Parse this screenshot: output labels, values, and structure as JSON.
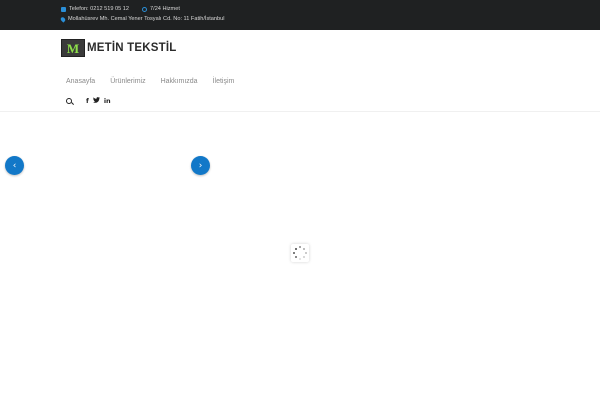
{
  "topbar": {
    "phone": "Telefon: 0212 519 05 12",
    "hours": "7/24 Hizmet",
    "address": "Mollahüsrev Mh. Cemal Yener Tosyalı Cd. No: 11 Fatih/İstanbul"
  },
  "logo": {
    "mark": "M",
    "text": "METİN TEKSTİL"
  },
  "nav": {
    "items": [
      "Anasayfa",
      "Ürünlerimiz",
      "Hakkımızda",
      "İletişim"
    ]
  },
  "social": {
    "facebook": "f",
    "twitter": "🐦",
    "linkedin": "in"
  },
  "slider": {
    "prev": "‹",
    "next": "›"
  },
  "colors": {
    "topbar_bg": "#1f2122",
    "accent": "#1278c8",
    "logo_green": "#8ee04a"
  },
  "icons": [
    "phone-icon",
    "clock-icon",
    "map-pin-icon",
    "search-icon",
    "facebook-icon",
    "twitter-icon",
    "linkedin-icon",
    "chevron-left-icon",
    "chevron-right-icon",
    "loading-spinner-icon"
  ]
}
